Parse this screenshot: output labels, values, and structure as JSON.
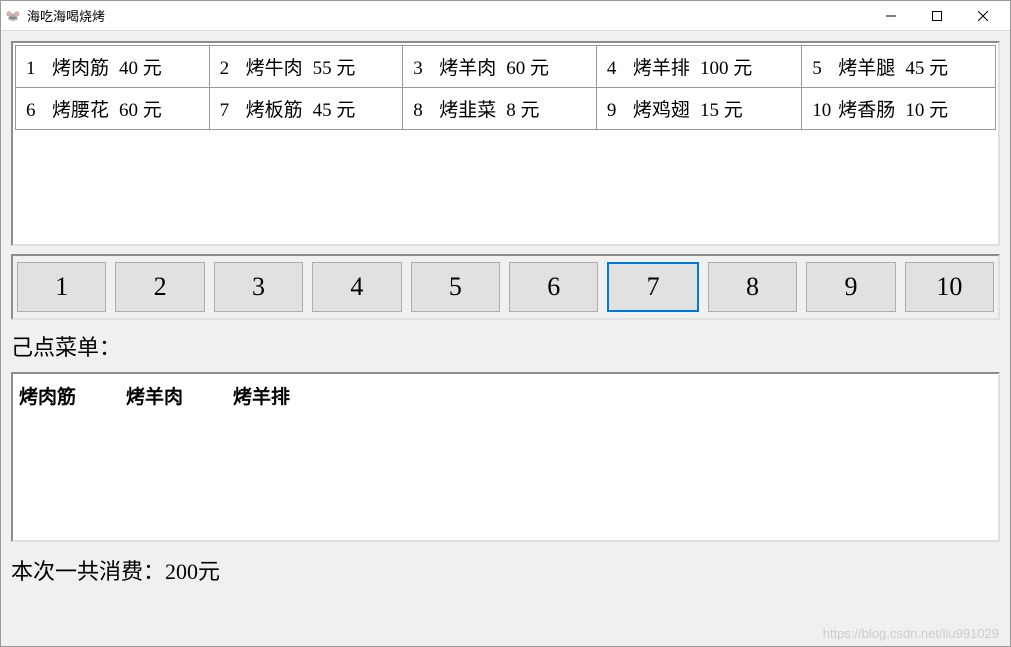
{
  "window": {
    "title": "海吃海喝烧烤",
    "icon_glyph": "🐭"
  },
  "menu_items": [
    {
      "index": "1",
      "name": "烤肉筋",
      "price": "40",
      "unit": "元"
    },
    {
      "index": "2",
      "name": "烤牛肉",
      "price": "55",
      "unit": "元"
    },
    {
      "index": "3",
      "name": "烤羊肉",
      "price": "60",
      "unit": "元"
    },
    {
      "index": "4",
      "name": "烤羊排",
      "price": "100",
      "unit": "元"
    },
    {
      "index": "5",
      "name": "烤羊腿",
      "price": "45",
      "unit": "元"
    },
    {
      "index": "6",
      "name": "烤腰花",
      "price": "60",
      "unit": "元"
    },
    {
      "index": "7",
      "name": "烤板筋",
      "price": "45",
      "unit": "元"
    },
    {
      "index": "8",
      "name": "烤韭菜",
      "price": "8",
      "unit": "元"
    },
    {
      "index": "9",
      "name": "烤鸡翅",
      "price": "15",
      "unit": "元"
    },
    {
      "index": "10",
      "name": "烤香肠",
      "price": "10",
      "unit": "元"
    }
  ],
  "number_buttons": [
    {
      "label": "1",
      "selected": false
    },
    {
      "label": "2",
      "selected": false
    },
    {
      "label": "3",
      "selected": false
    },
    {
      "label": "4",
      "selected": false
    },
    {
      "label": "5",
      "selected": false
    },
    {
      "label": "6",
      "selected": false
    },
    {
      "label": "7",
      "selected": true
    },
    {
      "label": "8",
      "selected": false
    },
    {
      "label": "9",
      "selected": false
    },
    {
      "label": "10",
      "selected": false
    }
  ],
  "ordered_label": "己点菜单：",
  "ordered_items": [
    "烤肉筋",
    "烤羊肉",
    "烤羊排"
  ],
  "total_line": "本次一共消费：200元",
  "watermark": "https://blog.csdn.net/liu991029"
}
